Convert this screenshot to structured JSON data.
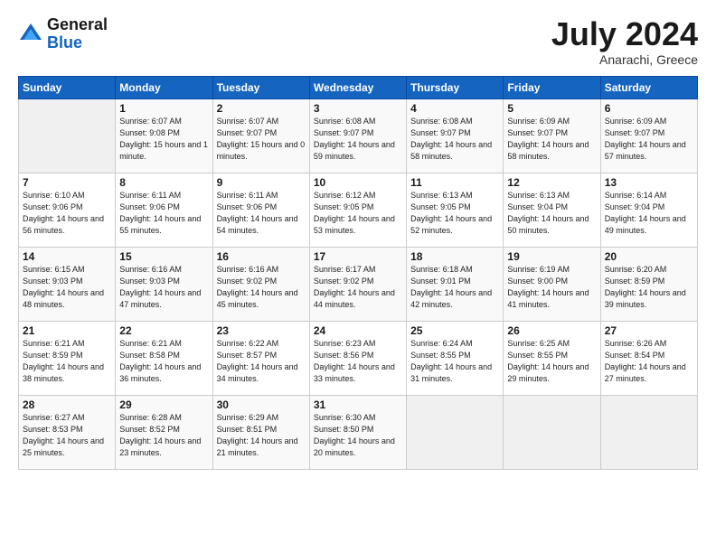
{
  "logo": {
    "general": "General",
    "blue": "Blue"
  },
  "header": {
    "month": "July 2024",
    "location": "Anarachi, Greece"
  },
  "weekdays": [
    "Sunday",
    "Monday",
    "Tuesday",
    "Wednesday",
    "Thursday",
    "Friday",
    "Saturday"
  ],
  "weeks": [
    [
      {
        "num": "",
        "sunrise": "",
        "sunset": "",
        "daylight": "",
        "empty": true
      },
      {
        "num": "1",
        "sunrise": "Sunrise: 6:07 AM",
        "sunset": "Sunset: 9:08 PM",
        "daylight": "Daylight: 15 hours and 1 minute."
      },
      {
        "num": "2",
        "sunrise": "Sunrise: 6:07 AM",
        "sunset": "Sunset: 9:07 PM",
        "daylight": "Daylight: 15 hours and 0 minutes."
      },
      {
        "num": "3",
        "sunrise": "Sunrise: 6:08 AM",
        "sunset": "Sunset: 9:07 PM",
        "daylight": "Daylight: 14 hours and 59 minutes."
      },
      {
        "num": "4",
        "sunrise": "Sunrise: 6:08 AM",
        "sunset": "Sunset: 9:07 PM",
        "daylight": "Daylight: 14 hours and 58 minutes."
      },
      {
        "num": "5",
        "sunrise": "Sunrise: 6:09 AM",
        "sunset": "Sunset: 9:07 PM",
        "daylight": "Daylight: 14 hours and 58 minutes."
      },
      {
        "num": "6",
        "sunrise": "Sunrise: 6:09 AM",
        "sunset": "Sunset: 9:07 PM",
        "daylight": "Daylight: 14 hours and 57 minutes."
      }
    ],
    [
      {
        "num": "7",
        "sunrise": "Sunrise: 6:10 AM",
        "sunset": "Sunset: 9:06 PM",
        "daylight": "Daylight: 14 hours and 56 minutes."
      },
      {
        "num": "8",
        "sunrise": "Sunrise: 6:11 AM",
        "sunset": "Sunset: 9:06 PM",
        "daylight": "Daylight: 14 hours and 55 minutes."
      },
      {
        "num": "9",
        "sunrise": "Sunrise: 6:11 AM",
        "sunset": "Sunset: 9:06 PM",
        "daylight": "Daylight: 14 hours and 54 minutes."
      },
      {
        "num": "10",
        "sunrise": "Sunrise: 6:12 AM",
        "sunset": "Sunset: 9:05 PM",
        "daylight": "Daylight: 14 hours and 53 minutes."
      },
      {
        "num": "11",
        "sunrise": "Sunrise: 6:13 AM",
        "sunset": "Sunset: 9:05 PM",
        "daylight": "Daylight: 14 hours and 52 minutes."
      },
      {
        "num": "12",
        "sunrise": "Sunrise: 6:13 AM",
        "sunset": "Sunset: 9:04 PM",
        "daylight": "Daylight: 14 hours and 50 minutes."
      },
      {
        "num": "13",
        "sunrise": "Sunrise: 6:14 AM",
        "sunset": "Sunset: 9:04 PM",
        "daylight": "Daylight: 14 hours and 49 minutes."
      }
    ],
    [
      {
        "num": "14",
        "sunrise": "Sunrise: 6:15 AM",
        "sunset": "Sunset: 9:03 PM",
        "daylight": "Daylight: 14 hours and 48 minutes."
      },
      {
        "num": "15",
        "sunrise": "Sunrise: 6:16 AM",
        "sunset": "Sunset: 9:03 PM",
        "daylight": "Daylight: 14 hours and 47 minutes."
      },
      {
        "num": "16",
        "sunrise": "Sunrise: 6:16 AM",
        "sunset": "Sunset: 9:02 PM",
        "daylight": "Daylight: 14 hours and 45 minutes."
      },
      {
        "num": "17",
        "sunrise": "Sunrise: 6:17 AM",
        "sunset": "Sunset: 9:02 PM",
        "daylight": "Daylight: 14 hours and 44 minutes."
      },
      {
        "num": "18",
        "sunrise": "Sunrise: 6:18 AM",
        "sunset": "Sunset: 9:01 PM",
        "daylight": "Daylight: 14 hours and 42 minutes."
      },
      {
        "num": "19",
        "sunrise": "Sunrise: 6:19 AM",
        "sunset": "Sunset: 9:00 PM",
        "daylight": "Daylight: 14 hours and 41 minutes."
      },
      {
        "num": "20",
        "sunrise": "Sunrise: 6:20 AM",
        "sunset": "Sunset: 8:59 PM",
        "daylight": "Daylight: 14 hours and 39 minutes."
      }
    ],
    [
      {
        "num": "21",
        "sunrise": "Sunrise: 6:21 AM",
        "sunset": "Sunset: 8:59 PM",
        "daylight": "Daylight: 14 hours and 38 minutes."
      },
      {
        "num": "22",
        "sunrise": "Sunrise: 6:21 AM",
        "sunset": "Sunset: 8:58 PM",
        "daylight": "Daylight: 14 hours and 36 minutes."
      },
      {
        "num": "23",
        "sunrise": "Sunrise: 6:22 AM",
        "sunset": "Sunset: 8:57 PM",
        "daylight": "Daylight: 14 hours and 34 minutes."
      },
      {
        "num": "24",
        "sunrise": "Sunrise: 6:23 AM",
        "sunset": "Sunset: 8:56 PM",
        "daylight": "Daylight: 14 hours and 33 minutes."
      },
      {
        "num": "25",
        "sunrise": "Sunrise: 6:24 AM",
        "sunset": "Sunset: 8:55 PM",
        "daylight": "Daylight: 14 hours and 31 minutes."
      },
      {
        "num": "26",
        "sunrise": "Sunrise: 6:25 AM",
        "sunset": "Sunset: 8:55 PM",
        "daylight": "Daylight: 14 hours and 29 minutes."
      },
      {
        "num": "27",
        "sunrise": "Sunrise: 6:26 AM",
        "sunset": "Sunset: 8:54 PM",
        "daylight": "Daylight: 14 hours and 27 minutes."
      }
    ],
    [
      {
        "num": "28",
        "sunrise": "Sunrise: 6:27 AM",
        "sunset": "Sunset: 8:53 PM",
        "daylight": "Daylight: 14 hours and 25 minutes."
      },
      {
        "num": "29",
        "sunrise": "Sunrise: 6:28 AM",
        "sunset": "Sunset: 8:52 PM",
        "daylight": "Daylight: 14 hours and 23 minutes."
      },
      {
        "num": "30",
        "sunrise": "Sunrise: 6:29 AM",
        "sunset": "Sunset: 8:51 PM",
        "daylight": "Daylight: 14 hours and 21 minutes."
      },
      {
        "num": "31",
        "sunrise": "Sunrise: 6:30 AM",
        "sunset": "Sunset: 8:50 PM",
        "daylight": "Daylight: 14 hours and 20 minutes."
      },
      {
        "num": "",
        "sunrise": "",
        "sunset": "",
        "daylight": "",
        "empty": true
      },
      {
        "num": "",
        "sunrise": "",
        "sunset": "",
        "daylight": "",
        "empty": true
      },
      {
        "num": "",
        "sunrise": "",
        "sunset": "",
        "daylight": "",
        "empty": true
      }
    ]
  ]
}
